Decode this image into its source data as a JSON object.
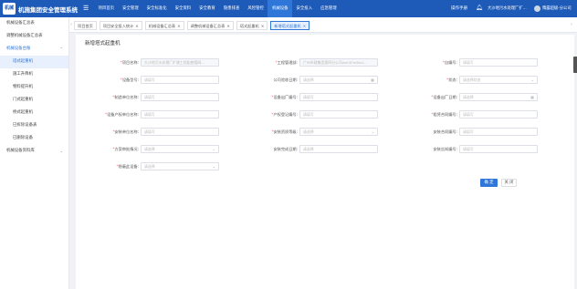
{
  "app": {
    "logo_text": "机械智慧",
    "title": "机施集团安全管理系统"
  },
  "nav": [
    "项目首页",
    "安全管理",
    "安全标准化",
    "安全资料",
    "安全教育",
    "隐患排查",
    "风险管控",
    "机械设备",
    "安全投入",
    "应急管理"
  ],
  "header": {
    "manual": "操作手册",
    "org": "大沙地污水处理厂扩...",
    "user": "隋露超级-分公司"
  },
  "sidebar": [
    {
      "label": "机械设备汇总表"
    },
    {
      "label": "调整机械设备汇总表"
    },
    {
      "label": "机械设备台账"
    },
    {
      "label": "塔式起重机"
    },
    {
      "label": "施工升降机"
    },
    {
      "label": "物料提升机"
    },
    {
      "label": "门式起重机"
    },
    {
      "label": "桥式起重机"
    },
    {
      "label": "已拆除设备表"
    },
    {
      "label": "已删除设备"
    },
    {
      "label": "机械设备资料库"
    }
  ],
  "tabs": [
    "项目首页",
    "项目安全投入统计",
    "机械设备汇总表",
    "调整机械设备汇总表",
    "塔式起重机",
    "新增塔式起重机"
  ],
  "form": {
    "title": "新增塔式起重机",
    "project_name": {
      "label": "项目名称:",
      "value": "大沙地污水处理厂扩建工程配套管网..."
    },
    "project_manager": {
      "label": "工程管理部:",
      "value": "广州市政集团第四分公司wxrSFm8nd..."
    },
    "self_number": {
      "label": "自编号:",
      "placeholder": "请填写"
    },
    "device_model": {
      "label": "设备型号:",
      "placeholder": "请填写"
    },
    "company_entry_date": {
      "label": "公司验收日期:",
      "placeholder": "请选择"
    },
    "status": {
      "label": "状态:",
      "placeholder": "请选择状态"
    },
    "manufacturer": {
      "label": "制造单位名称:",
      "placeholder": "请填写"
    },
    "factory_number": {
      "label": "设备出厂编号:",
      "placeholder": "请填写"
    },
    "factory_date": {
      "label": "设备出厂日期:",
      "placeholder": "请选择"
    },
    "owner_name": {
      "label": "设备产权单位名称:",
      "placeholder": "请填写"
    },
    "property_reg": {
      "label": "产权登记编号:",
      "placeholder": "请填写"
    },
    "lease_contract": {
      "label": "租赁合同编号:",
      "placeholder": "请填写"
    },
    "install_unit": {
      "label": "安装单位名称:",
      "placeholder": "请填写"
    },
    "install_qual": {
      "label": "安装资质等级:",
      "placeholder": "请选择"
    },
    "install_contract": {
      "label": "安装合同编号:",
      "placeholder": "请填写"
    },
    "inspection_result": {
      "label": "方案审批情况:",
      "placeholder": "请选择"
    },
    "install_done_date": {
      "label": "安装完成日期:",
      "placeholder": "请选择"
    },
    "install_notice": {
      "label": "安装告知编号:",
      "placeholder": "请填写"
    },
    "removed": {
      "label": "隐蔽此设备:",
      "placeholder": "请选择"
    },
    "confirm": "确 定",
    "cancel": "关 闭"
  }
}
